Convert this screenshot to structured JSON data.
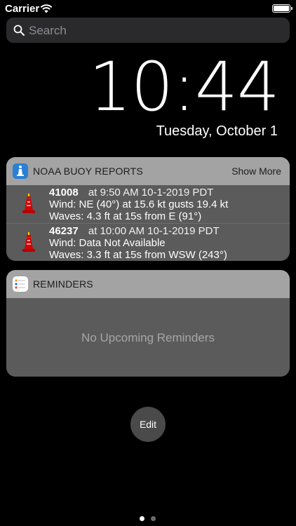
{
  "status_bar": {
    "carrier": "Carrier"
  },
  "search": {
    "placeholder": "Search"
  },
  "lockscreen": {
    "time": "10:44",
    "date": "Tuesday, October 1"
  },
  "noaa_widget": {
    "title": "NOAA BUOY REPORTS",
    "show_more": "Show More",
    "reports": [
      {
        "station": "41008",
        "observed": "at 9:50 AM 10-1-2019 PDT",
        "wind": "Wind: NE (40°) at 15.6 kt gusts 19.4 kt",
        "waves": "Waves: 4.3 ft at 15s from E (91°)"
      },
      {
        "station": "46237",
        "observed": "at 10:00 AM 10-1-2019 PDT",
        "wind": "Wind: Data Not Available",
        "waves": "Waves: 3.3 ft at 15s from WSW (243°)"
      }
    ]
  },
  "reminders_widget": {
    "title": "REMINDERS",
    "empty_message": "No Upcoming Reminders"
  },
  "edit_button": {
    "label": "Edit"
  },
  "page_indicator": {
    "current": 1,
    "total": 2
  },
  "icons": [
    "wifi-icon",
    "battery-icon",
    "search-icon",
    "noaa-app-icon",
    "buoy-icon",
    "reminders-app-icon"
  ]
}
